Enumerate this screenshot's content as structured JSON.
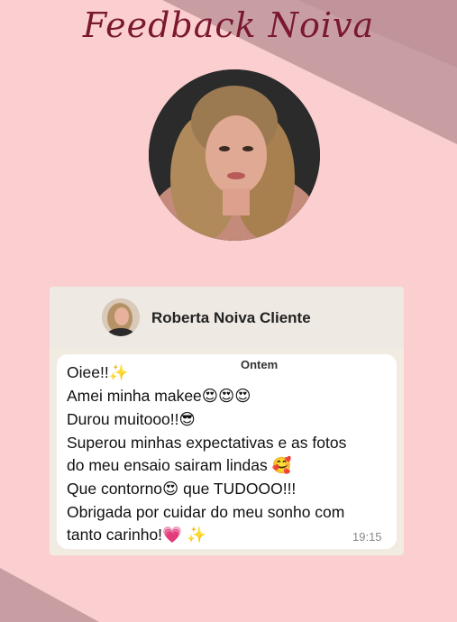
{
  "page": {
    "title": "Feedback Noiva"
  },
  "chat": {
    "contact_name": "Roberta Noiva Cliente",
    "date_label": "Ontem",
    "time": "19:15",
    "lines": [
      {
        "text": "Oiee!!",
        "emoji": "✨"
      },
      {
        "text": "Amei minha makee",
        "emoji": "😍😍😍"
      },
      {
        "text": "Durou muitooo!!",
        "emoji": "😎"
      },
      {
        "text": "Superou minhas expectativas e as fotos",
        "emoji": ""
      },
      {
        "text": "do meu ensaio sairam lindas ",
        "emoji": "🥰"
      },
      {
        "text": "Que contorno",
        "emoji": "😍",
        "tail": " que TUDOOO!!!"
      },
      {
        "text": "Obrigada por cuidar do meu sonho com",
        "emoji": ""
      },
      {
        "text": "tanto carinho!",
        "emoji": "💗 ✨"
      }
    ]
  },
  "colors": {
    "background": "#fbcfcf",
    "title": "#7a1830",
    "accent_diagonal": "#c89b9f"
  },
  "icons": {
    "profile_photo": "bride-portrait",
    "header_avatar": "contact-avatar"
  }
}
